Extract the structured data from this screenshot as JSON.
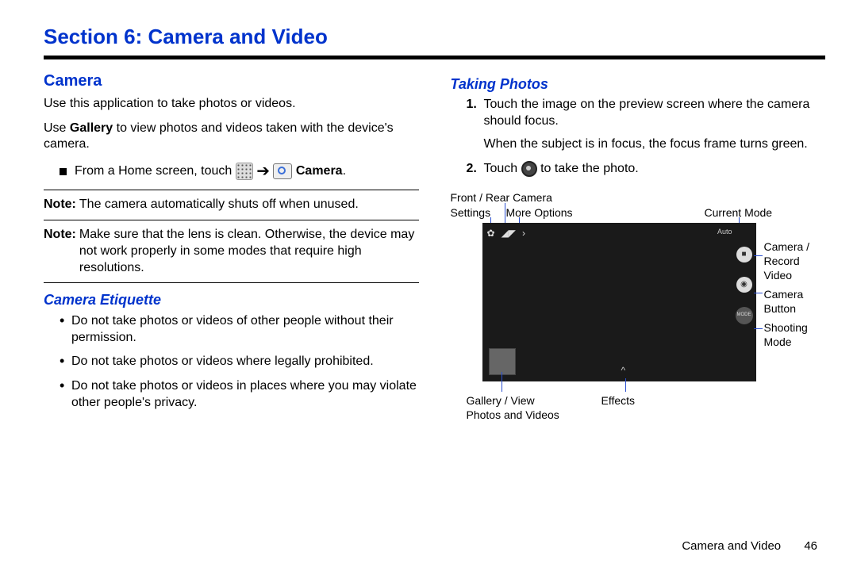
{
  "section_title": "Section 6: Camera and Video",
  "left": {
    "h2": "Camera",
    "p1": "Use this application to take photos or videos.",
    "p2_pre": "Use ",
    "p2_bold": "Gallery",
    "p2_post": " to view photos and videos taken with the device's camera.",
    "step_pre": "From a Home screen, touch ",
    "step_bold": "Camera",
    "step_post": ".",
    "note1_label": "Note:",
    "note1_text": " The camera automatically shuts off when unused.",
    "note2_label": "Note:",
    "note2_text": " Make sure that the lens is clean. Otherwise, the device may not work properly in some modes that require high resolutions.",
    "h3": "Camera Etiquette",
    "bullets": [
      "Do not take photos or videos of other people without their permission.",
      "Do not take photos or videos where legally prohibited.",
      "Do not take photos or videos in places where you may violate other people's privacy."
    ]
  },
  "right": {
    "h3": "Taking Photos",
    "step1": "Touch the image on the preview screen where the camera should focus.",
    "step1b": "When the subject is in focus, the focus frame turns green.",
    "step2_pre": "Touch ",
    "step2_post": " to take the photo.",
    "labels": {
      "settings": "Settings",
      "front_rear": "Front / Rear Camera",
      "more": "More Options",
      "current_mode": "Current Mode",
      "rec": "Camera / Record Video",
      "cam_btn": "Camera Button",
      "shoot_mode": "Shooting Mode",
      "gallery": "Gallery / View Photos and Videos",
      "effects": "Effects"
    },
    "screen": {
      "auto": "Auto",
      "mode": "MODE",
      "effects_glyph": "^"
    }
  },
  "footer": {
    "text": "Camera and Video",
    "page": "46"
  }
}
